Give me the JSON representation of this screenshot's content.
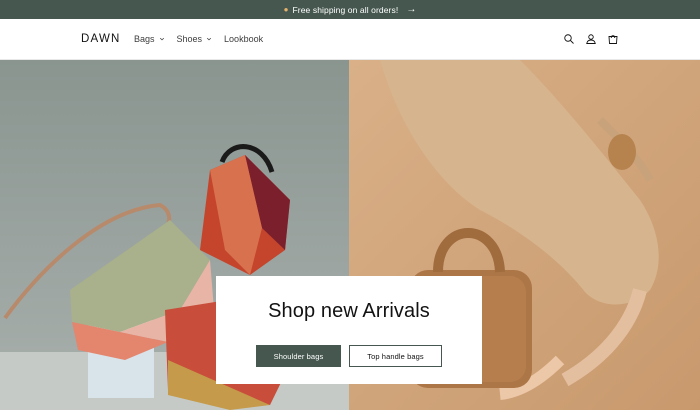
{
  "announcement": {
    "emoji_icon": "orange-sparkle-icon",
    "text": "Free shipping on all orders!",
    "arrow_icon": "arrow-right-icon"
  },
  "header": {
    "logo": "DAWN",
    "nav": [
      {
        "label": "Bags",
        "has_dropdown": true
      },
      {
        "label": "Shoes",
        "has_dropdown": true
      },
      {
        "label": "Lookbook",
        "has_dropdown": false
      }
    ],
    "icons": [
      "search-icon",
      "account-icon",
      "cart-icon"
    ]
  },
  "hero": {
    "left_background": "#7d8a85",
    "right_background": "#d7ad82",
    "promo": {
      "title": "Shop new Arrivals",
      "primary_button": "Shoulder bags",
      "secondary_button": "Top handle bags"
    }
  },
  "colors": {
    "accent": "#45574f",
    "text": "#121212"
  }
}
